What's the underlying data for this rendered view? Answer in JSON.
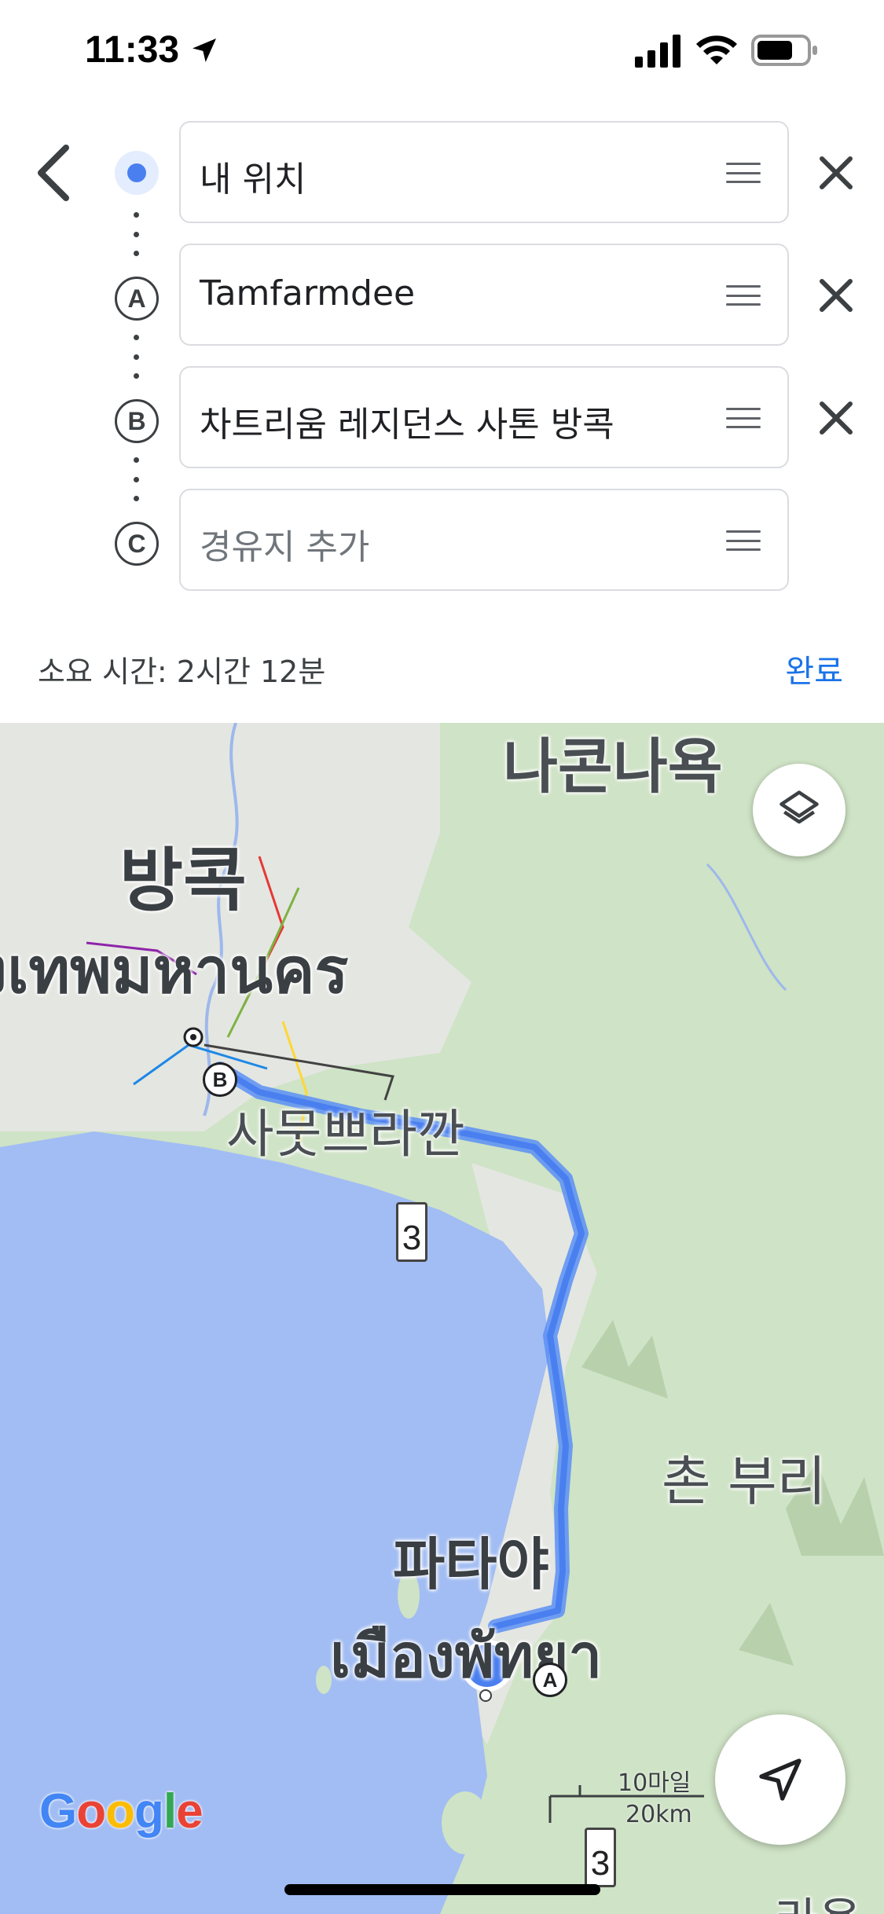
{
  "status_bar": {
    "time": "11:33"
  },
  "directions": {
    "waypoints": [
      {
        "marker": "",
        "value": "내 위치",
        "placeholder": ""
      },
      {
        "marker": "A",
        "value": "Tamfarmdee",
        "placeholder": ""
      },
      {
        "marker": "B",
        "value": "차트리움 레지던스 사톤 방콕",
        "placeholder": ""
      },
      {
        "marker": "C",
        "value": "",
        "placeholder": "경유지 추가"
      }
    ],
    "duration": "소요 시간: 2시간 12분",
    "done_label": "완료"
  },
  "map": {
    "labels": {
      "nakhon": "나콘나욕",
      "bangkok_ko": "방콕",
      "bangkok_th": "งเทพมหานคร",
      "samut": "사뭇쁘라깐",
      "chon": "촌 부리",
      "pattaya_ko": "파타야",
      "pattaya_th": "เมืองพัทยา",
      "bottom": "라용"
    },
    "road_shields": [
      "3",
      "3"
    ],
    "pins": {
      "a": "A",
      "b": "B"
    },
    "google_logo": {
      "g1": "G",
      "o1": "o",
      "o2": "o",
      "g2": "g",
      "l": "l",
      "e": "e"
    },
    "scale": {
      "miles": "10마일",
      "km": "20km"
    },
    "colors": {
      "route": "#5b8ff5",
      "water": "#a2bdf3",
      "land": "#cfe3c6",
      "urban": "#e6e6e6",
      "accent": "#1a73e8"
    }
  },
  "icons": {
    "back": "chevron-left-icon",
    "close": "close-icon",
    "drag": "drag-handle-icon",
    "layers": "layers-icon",
    "navigate": "navigation-arrow-icon"
  }
}
